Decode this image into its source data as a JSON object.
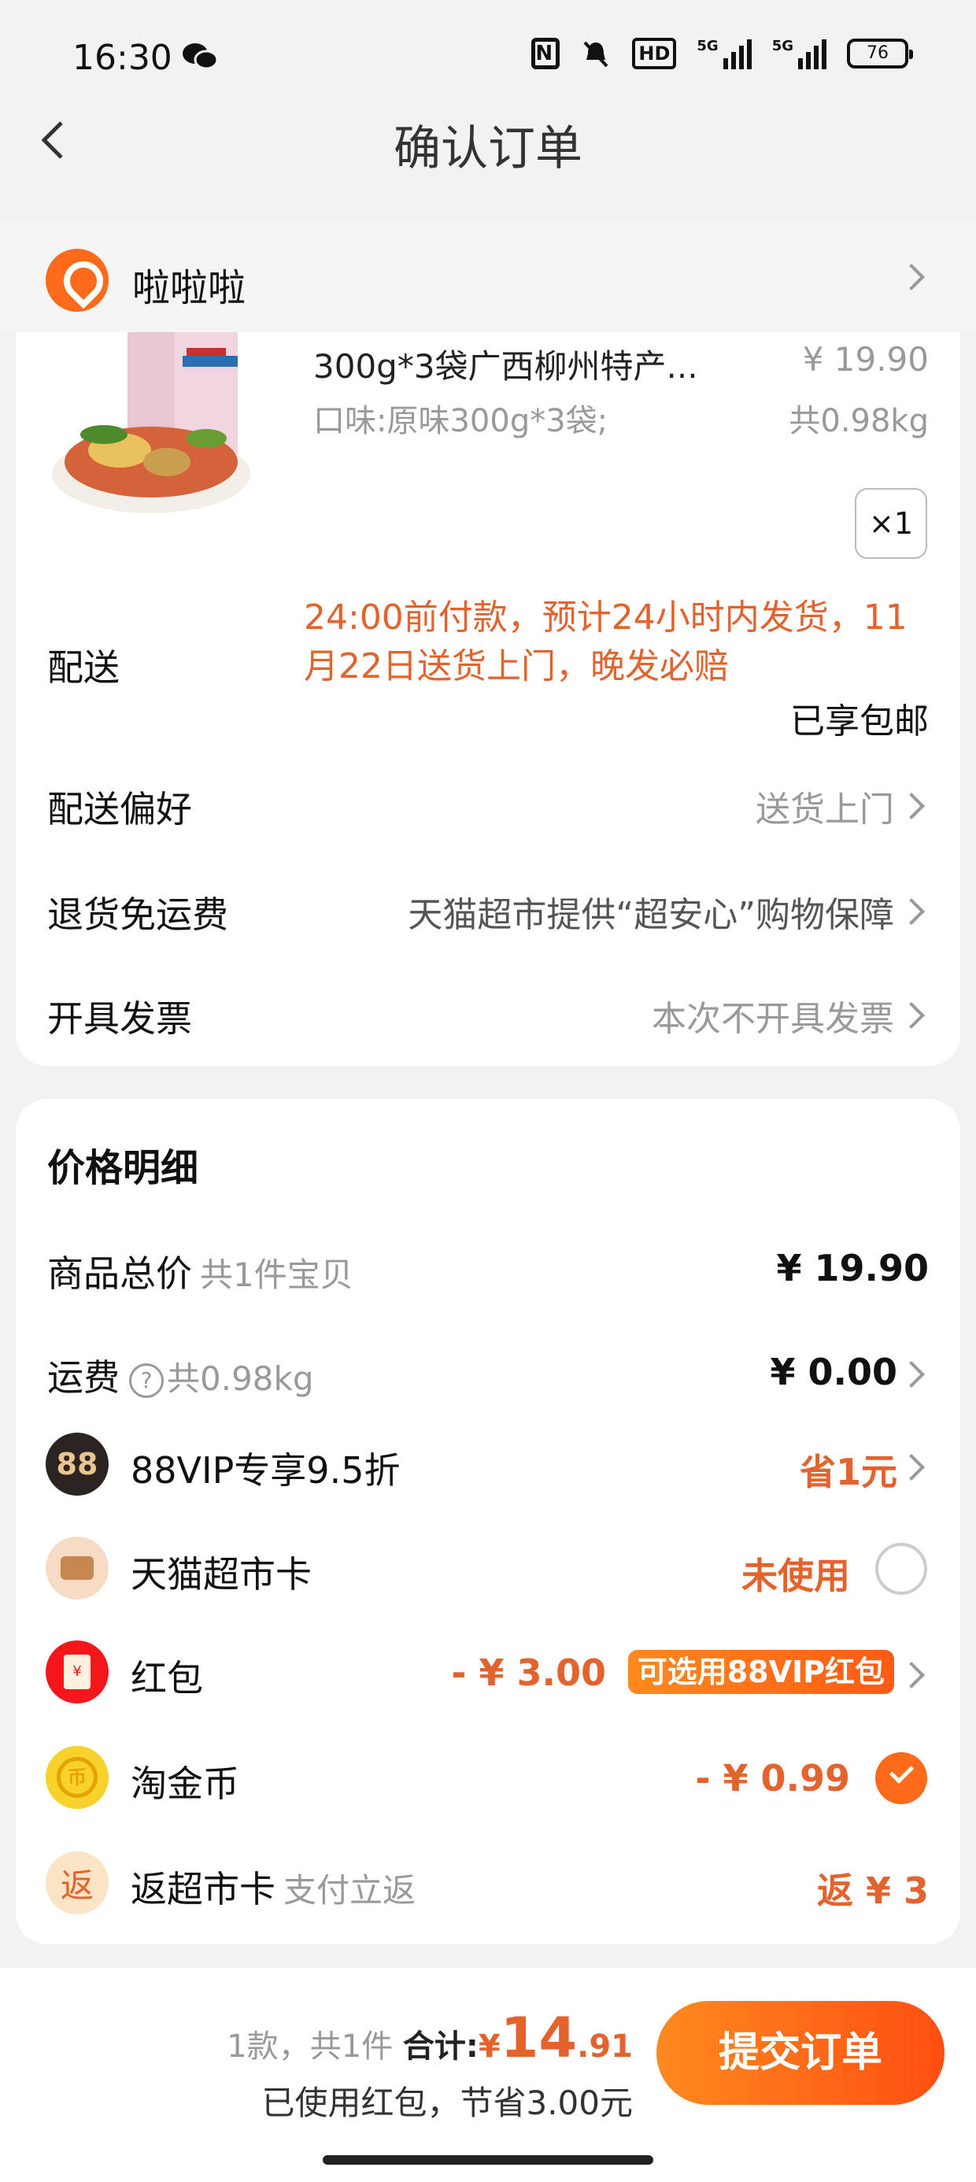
{
  "status_bar": {
    "time": "16:30",
    "hd_label": "HD",
    "signal1_label": "5G",
    "signal2_label": "5G",
    "battery": "76"
  },
  "header": {
    "title": "确认订单"
  },
  "address": {
    "name": "啦啦啦"
  },
  "product": {
    "title": "300g*3袋广西柳州特产...",
    "price": "¥ 19.90",
    "spec": "口味:原味300g*3袋;",
    "weight": "共0.98kg",
    "qty": "×1"
  },
  "delivery": {
    "label": "配送",
    "note": "24:00前付款，预计24小时内发货，11月22日送货上门，晚发必赔",
    "shipping": "已享包邮"
  },
  "options": {
    "pref_label": "配送偏好",
    "pref_value": "送货上门",
    "return_label": "退货免运费",
    "return_value": "天猫超市提供“超安心”购物保障",
    "invoice_label": "开具发票",
    "invoice_value": "本次不开具发票"
  },
  "price_detail": {
    "title": "价格明细",
    "total_label": "商品总价",
    "total_sub": "共1件宝贝",
    "total_value": "¥ 19.90",
    "freight_label": "运费",
    "freight_sub": "共0.98kg",
    "freight_value": "¥ 0.00",
    "vip_icon": "88",
    "vip_label": "88VIP专享9.5折",
    "vip_value": "省1元",
    "card_label": "天猫超市卡",
    "card_value": "未使用",
    "hb_label": "红包",
    "hb_value": "- ¥ 3.00",
    "hb_pill": "可选用88VIP红包",
    "coin_label": "淘金币",
    "coin_value": "- ¥ 0.99",
    "fan_icon": "返",
    "fan_label": "返超市卡",
    "fan_sub": "支付立返",
    "fan_value": "返 ¥ 3"
  },
  "summary": {
    "count": "1款，共1件",
    "total_label": "合计:",
    "currency": "¥",
    "int": "14",
    "dec": ".91",
    "saved": "已使用红包，节省3.00元",
    "submit": "提交订单"
  },
  "icons": [
    "wechat-icon",
    "nfc-icon",
    "mute-icon",
    "back-icon",
    "location-pin-icon",
    "chevron-right-icon",
    "help-icon",
    "vip88-icon",
    "card-icon",
    "red-packet-icon",
    "gold-coin-icon",
    "rebate-icon",
    "check-icon"
  ],
  "colors": {
    "accent": "#ff6a1a",
    "price_orange": "#e4622b"
  }
}
